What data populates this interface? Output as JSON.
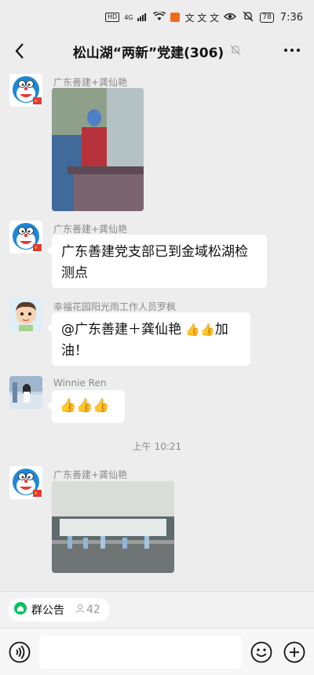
{
  "status_bar": {
    "signal_label": "4G",
    "app_icons": "文 文 文",
    "battery": "78",
    "time": "7:36"
  },
  "header": {
    "title": "松山湖“两新”党建(306)"
  },
  "messages": [
    {
      "sender": "广东善建+龚仙艳",
      "type": "image"
    },
    {
      "sender": "广东善建+龚仙艳",
      "type": "text",
      "line1": "广东善建党支部已到金域松湖检",
      "line2": "测点"
    },
    {
      "sender": "幸福花园阳光雨工作人员罗枫",
      "type": "text",
      "line1_a": "@广东善建＋龚仙艳",
      "line1_b": "加",
      "line2": "油！"
    },
    {
      "sender": "Winnie Ren",
      "type": "emoji"
    },
    {
      "sender": "广东善建+龚仙艳",
      "type": "image"
    }
  ],
  "time_separator": "上午 10:21",
  "notice": {
    "label": "群公告",
    "count": "42"
  },
  "colors": {
    "background": "#ededed",
    "bubble": "#ffffff",
    "notice_icon": "#07c160"
  }
}
